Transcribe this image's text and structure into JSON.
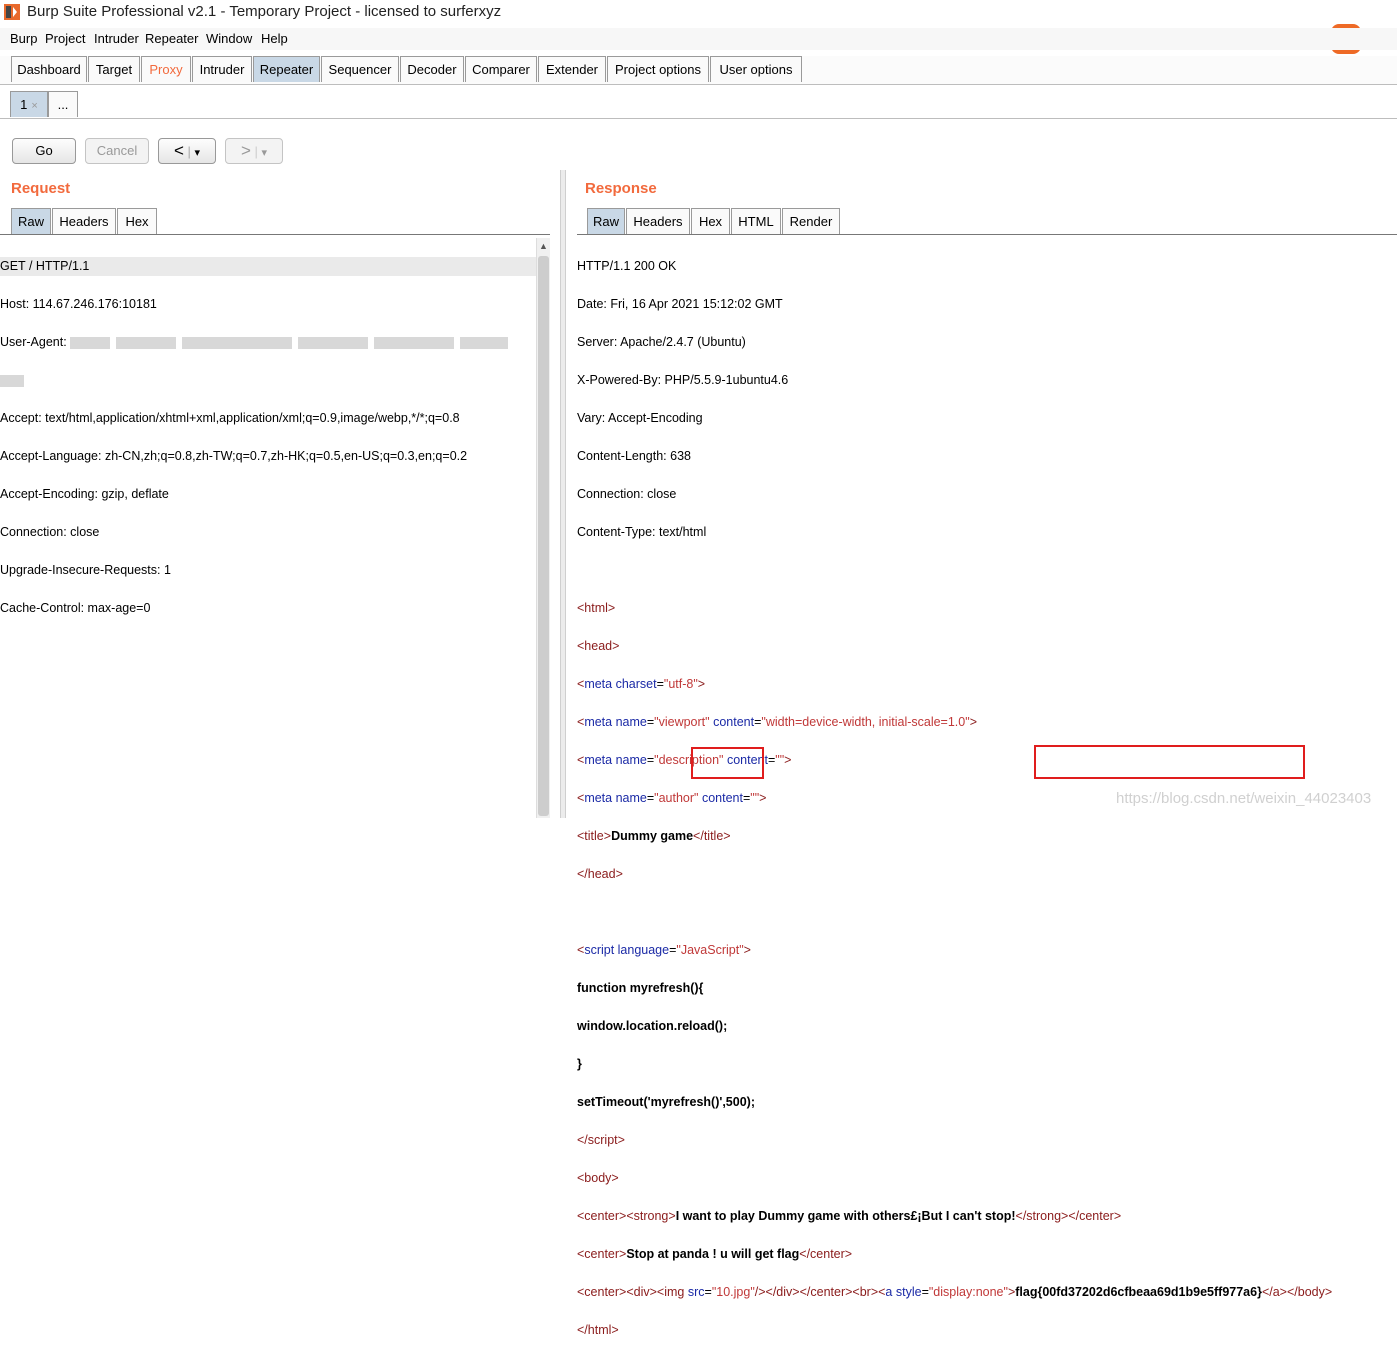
{
  "window": {
    "title": "Burp Suite Professional v2.1 - Temporary Project - licensed to surferxyz"
  },
  "menu": [
    "Burp",
    "Project",
    "Intruder",
    "Repeater",
    "Window",
    "Help"
  ],
  "ime": {
    "label": "中"
  },
  "main_tabs": [
    "Dashboard",
    "Target",
    "Proxy",
    "Intruder",
    "Repeater",
    "Sequencer",
    "Decoder",
    "Comparer",
    "Extender",
    "Project options",
    "User options"
  ],
  "repeater_tabs": {
    "tab1": "1",
    "tab1_close": "×",
    "more": "..."
  },
  "toolbar": {
    "go": "Go",
    "cancel": "Cancel",
    "back": "<",
    "forward": ">",
    "dropdown": "▾"
  },
  "request": {
    "title": "Request",
    "tabs": [
      "Raw",
      "Headers",
      "Hex"
    ],
    "lines": [
      "GET / HTTP/1.1",
      "Host: 114.67.246.176:10181",
      "User-Agent:",
      "Accept: text/html,application/xhtml+xml,application/xml;q=0.9,image/webp,*/*;q=0.8",
      "Accept-Language: zh-CN,zh;q=0.8,zh-TW;q=0.7,zh-HK;q=0.5,en-US;q=0.3,en;q=0.2",
      "Accept-Encoding: gzip, deflate",
      "Connection: close",
      "Upgrade-Insecure-Requests: 1",
      "Cache-Control: max-age=0"
    ]
  },
  "response": {
    "title": "Response",
    "tabs": [
      "Raw",
      "Headers",
      "Hex",
      "HTML",
      "Render"
    ],
    "headers": [
      "HTTP/1.1 200 OK",
      "Date: Fri, 16 Apr 2021 15:12:02 GMT",
      "Server: Apache/2.4.7 (Ubuntu)",
      "X-Powered-By: PHP/5.5.9-1ubuntu4.6",
      "Vary: Accept-Encoding",
      "Content-Length: 638",
      "Connection: close",
      "Content-Type: text/html"
    ],
    "body": {
      "title_text": "Dummy game",
      "script_lines": [
        "function myrefresh(){",
        "window.location.reload();",
        "}",
        "setTimeout('myrefresh()',500);"
      ],
      "center1": "I want to play Dummy game with others£¡But I can't stop!",
      "center2": "Stop at panda ! u will get flag",
      "img_src": "\"10.jpg\"",
      "flag": "flag{00fd37202d6cfbeaa69d1b9e5ff977a6}"
    }
  },
  "watermark": "https://blog.csdn.net/weixin_44023403"
}
